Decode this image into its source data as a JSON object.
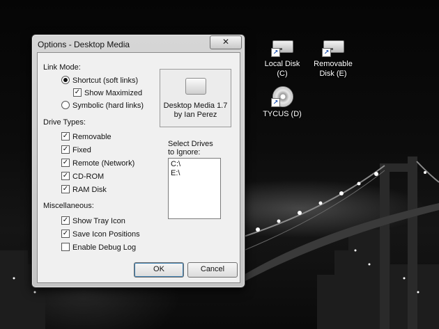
{
  "desktop": {
    "icons": [
      {
        "label_line1": "Local Disk",
        "label_line2": "(C)"
      },
      {
        "label_line1": "Removable",
        "label_line2": "Disk (E)"
      },
      {
        "label_line1": "TYCUS (D)",
        "label_line2": ""
      }
    ]
  },
  "dialog": {
    "title": "Options - Desktop Media",
    "close_symbol": "✕",
    "link_mode": {
      "heading": "Link Mode:",
      "shortcut_label": "Shortcut (soft links)",
      "shortcut_selected": true,
      "show_maximized_label": "Show Maximized",
      "show_maximized_checked": true,
      "symbolic_label": "Symbolic (hard links)",
      "symbolic_selected": false
    },
    "drive_types": {
      "heading": "Drive Types:",
      "items": [
        {
          "label": "Removable",
          "checked": true
        },
        {
          "label": "Fixed",
          "checked": true
        },
        {
          "label": "Remote (Network)",
          "checked": true
        },
        {
          "label": "CD-ROM",
          "checked": true
        },
        {
          "label": "RAM Disk",
          "checked": true
        }
      ]
    },
    "misc": {
      "heading": "Miscellaneous:",
      "items": [
        {
          "label": "Show Tray Icon",
          "checked": true
        },
        {
          "label": "Save Icon Positions",
          "checked": true
        },
        {
          "label": "Enable Debug Log",
          "checked": false
        }
      ]
    },
    "about": {
      "line1": "Desktop Media 1.7",
      "line2": "by Ian Perez"
    },
    "ignore": {
      "label_line1": "Select Drives",
      "label_line2": "to Ignore:",
      "items": [
        "C:\\",
        "E:\\"
      ]
    },
    "ok_label": "OK",
    "cancel_label": "Cancel"
  }
}
